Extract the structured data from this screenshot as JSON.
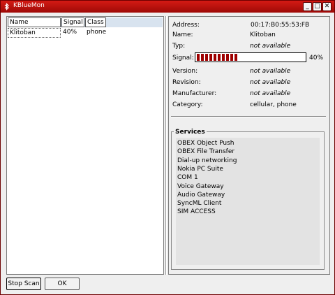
{
  "window": {
    "title": "KBlueMon",
    "min": "_",
    "max": "□",
    "close": "✕"
  },
  "device_list": {
    "columns": [
      "Name",
      "Signal",
      "Class"
    ],
    "rows": [
      {
        "name": "Klitoban",
        "signal": "40%",
        "class": "phone"
      }
    ]
  },
  "details": {
    "address_label": "Address:",
    "address_value": "00:17:B0:55:53:FB",
    "name_label": "Name:",
    "name_value": "Klitoban",
    "typ_label": "Typ:",
    "typ_value": "not available",
    "signal_label": "Signal:",
    "signal_value": "40%",
    "signal_fraction": 0.4,
    "version_label": "Version:",
    "version_value": "not available",
    "revision_label": "Revision:",
    "revision_value": "not available",
    "manufacturer_label": "Manufacturer:",
    "manufacturer_value": "not available",
    "category_label": "Category:",
    "category_value": "cellular, phone"
  },
  "services": {
    "title": "Services",
    "items": [
      "OBEX Object Push",
      "OBEX File Transfer",
      "Dial-up networking",
      "Nokia PC Suite",
      "COM 1",
      "Voice Gateway",
      "Audio Gateway",
      "SyncML Client",
      "SIM ACCESS"
    ]
  },
  "buttons": {
    "stop_scan": "Stop Scan",
    "ok": "OK"
  },
  "colors": {
    "titlebar": "#c4120e",
    "signal_fill": "#9e0000"
  }
}
